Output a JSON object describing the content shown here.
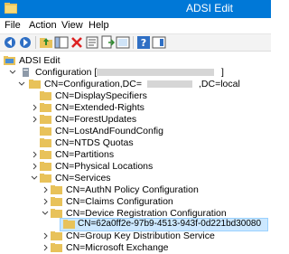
{
  "window": {
    "title": "ADSI Edit"
  },
  "menu": {
    "items": [
      "File",
      "Action",
      "View",
      "Help"
    ]
  },
  "toolbar": {
    "buttons": [
      "back-arrow-icon",
      "forward-arrow-icon",
      "up-folder-icon",
      "console-tree-icon",
      "delete-icon",
      "properties-icon",
      "export-list-icon",
      "refresh-icon",
      "help-icon",
      "show-hide-icon"
    ]
  },
  "tree": {
    "root": "ADSI Edit",
    "configuration": "Configuration [",
    "configuration_end": "]",
    "config_dn_prefix": "CN=Configuration,DC=",
    "config_dn_suffix": ",DC=local",
    "items": [
      "CN=DisplaySpecifiers",
      "CN=Extended-Rights",
      "CN=ForestUpdates",
      "CN=LostAndFoundConfig",
      "CN=NTDS Quotas",
      "CN=Partitions",
      "CN=Physical Locations",
      "CN=Services"
    ],
    "services_children": [
      "CN=AuthN Policy Configuration",
      "CN=Claims Configuration",
      "CN=Device Registration Configuration"
    ],
    "selected": "CN=62a0ff2e-97b9-4513-943f-0d221bd30080",
    "after": [
      "CN=Group Key Distribution Service",
      "CN=Microsoft Exchange"
    ]
  }
}
